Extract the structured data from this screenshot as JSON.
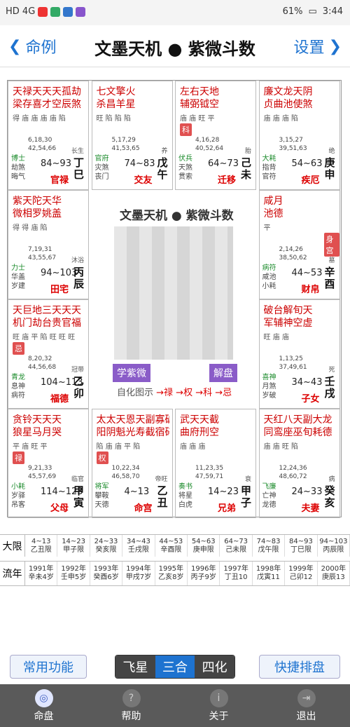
{
  "status": {
    "left": "HD 4G",
    "right": "61%",
    "time": "3:44"
  },
  "header": {
    "back_label": "命例",
    "title": "文墨天机 ● 紫微斗数",
    "settings_label": "设置"
  },
  "cells": [
    {
      "stars": "天禄天天天孤劫",
      "stars2": "梁存喜才空辰煞",
      "ranks": "得 庙 庙 庙 庙 陷",
      "ages": "6,18,30",
      "ages2": "42,54,66",
      "sub": "长生",
      "sl": "博士",
      "sl2": "劫煞",
      "sl3": "晦气",
      "range": "84~93",
      "gz": "丁巳",
      "pal": "官禄"
    },
    {
      "stars": "七文擎火",
      "stars2": "杀昌羊星",
      "ranks": "旺 陷 陷 陷",
      "ages": "5,17,29",
      "ages2": "41,53,65",
      "sub": "养",
      "sl": "官府",
      "sl2": "灾煞",
      "sl3": "丧门",
      "range": "74~83",
      "gz": "戊午",
      "pal": "交友"
    },
    {
      "stars": "左右天地",
      "stars2": "辅弼钺空",
      "ranks": "庙 庙 旺 平",
      "ages": "4,16,28",
      "ages2": "40,52,64",
      "sub": "胎",
      "sl": "伏兵",
      "sl2": "天煞",
      "sl3": "贯索",
      "range": "64~73",
      "gz": "己未",
      "pal": "迁移",
      "tag": "科"
    },
    {
      "stars": "廉文龙天阴",
      "stars2": "贞曲池使煞",
      "ranks": "庙 庙 庙 陷",
      "ages": "3,15,27",
      "ages2": "39,51,63",
      "sub": "绝",
      "sl": "大耗",
      "sl2": "指背",
      "sl3": "官符",
      "range": "54~63",
      "gz": "庚申",
      "pal": "疾厄"
    },
    {
      "stars": "紫天陀天华",
      "stars2": "微相罗姚盖",
      "ranks": "得 得 庙 陷",
      "ages": "7,19,31",
      "ages2": "43,55,67",
      "sub": "沐浴",
      "sl": "力士",
      "sl2": "华盖",
      "sl3": "岁建",
      "range": "94~103",
      "gz": "丙辰",
      "pal": "田宅"
    },
    {
      "stars": "咸月",
      "stars2": "池德",
      "ranks": "平",
      "ages": "2,14,26",
      "ages2": "38,50,62",
      "sub": "墓",
      "sl": "病符",
      "sl2": "咸池",
      "sl3": "小耗",
      "range": "44~53",
      "gz": "辛酉",
      "pal": "财帛",
      "tag": "身宫"
    },
    {
      "stars": "天巨地三天天天",
      "stars2": "机门劫台贵官福",
      "ranks": "旺 庙 平 陷 旺 旺 旺",
      "ages": "8,20,32",
      "ages2": "44,56,68",
      "sub": "冠带",
      "sl": "青龙",
      "sl2": "息神",
      "sl3": "病符",
      "range": "104~113",
      "gz": "乙卯",
      "pal": "福德",
      "tag": "忌"
    },
    {
      "stars": "破台解旬天",
      "stars2": "军辅神空虚",
      "ranks": "旺 庙 庙",
      "ages": "1,13,25",
      "ages2": "37,49,61",
      "sub": "死",
      "sl": "喜神",
      "sl2": "月煞",
      "sl3": "岁破",
      "range": "34~43",
      "gz": "壬戌",
      "pal": "子女"
    },
    {
      "stars": "贪铃天天天",
      "stars2": "狼星马月哭",
      "ranks": "平 庙 旺 平",
      "ages": "9,21,33",
      "ages2": "45,57,69",
      "sub": "临官",
      "sl": "小耗",
      "sl2": "岁驿",
      "sl3": "吊客",
      "range": "114~123",
      "gz": "甲寅",
      "pal": "父母",
      "tag": "禄"
    },
    {
      "stars": "太太天恩天副寡破天",
      "stars2": "阳阴魁光寿截宿碎德",
      "ranks": "陷 庙 庙 平 陷",
      "ages": "10,22,34",
      "ages2": "46,58,70",
      "sub": "帝旺",
      "sl": "将军",
      "sl2": "攀鞍",
      "sl3": "天德",
      "range": "4~13",
      "gz": "乙丑",
      "pal": "命宫",
      "tag": "权"
    },
    {
      "stars": "武天天截",
      "stars2": "曲府刑空",
      "ranks": "庙 庙 庙",
      "ages": "11,23,35",
      "ages2": "47,59,71",
      "sub": "衰",
      "sl": "奏书",
      "sl2": "将星",
      "sl3": "白虎",
      "range": "14~23",
      "gz": "甲子",
      "pal": "兄弟"
    },
    {
      "stars": "天红八天副大龙",
      "stars2": "同鸾座巫旬耗德",
      "ranks": "庙 庙 旺 陷",
      "ages": "12,24,36",
      "ages2": "48,60,72",
      "sub": "病",
      "sl": "飞廉",
      "sl2": "亡神",
      "sl3": "龙德",
      "range": "24~33",
      "gz": "癸亥",
      "pal": "夫妻"
    }
  ],
  "center": {
    "title": "文墨天机 ● 紫微斗数",
    "btn_left": "学紫微",
    "btn_right": "解盘",
    "auto_label": "自化图示",
    "auto_legend": "→禄 →权 →科 →忌"
  },
  "daxian": {
    "label": "大限",
    "items": [
      [
        "4~13",
        "乙丑限"
      ],
      [
        "14~23",
        "甲子限"
      ],
      [
        "24~33",
        "癸亥限"
      ],
      [
        "34~43",
        "壬戌限"
      ],
      [
        "44~53",
        "辛酉限"
      ],
      [
        "54~63",
        "庚申限"
      ],
      [
        "64~73",
        "己未限"
      ],
      [
        "74~83",
        "戊午限"
      ],
      [
        "84~93",
        "丁巳限"
      ],
      [
        "94~103",
        "丙辰限"
      ]
    ]
  },
  "liunian": {
    "label": "流年",
    "items": [
      [
        "1991年",
        "辛未4岁"
      ],
      [
        "1992年",
        "壬申5岁"
      ],
      [
        "1993年",
        "癸酉6岁"
      ],
      [
        "1994年",
        "甲戌7岁"
      ],
      [
        "1995年",
        "乙亥8岁"
      ],
      [
        "1996年",
        "丙子9岁"
      ],
      [
        "1997年",
        "丁丑10"
      ],
      [
        "1998年",
        "戊寅11"
      ],
      [
        "1999年",
        "己卯12"
      ],
      [
        "2000年",
        "庚辰13"
      ]
    ]
  },
  "toolbar": {
    "left": "常用功能",
    "seg1": "飞星",
    "seg2": "三合",
    "seg3": "四化",
    "right": "快捷排盘"
  },
  "nav": [
    {
      "label": "命盘"
    },
    {
      "label": "帮助"
    },
    {
      "label": "关于"
    },
    {
      "label": "退出"
    }
  ]
}
